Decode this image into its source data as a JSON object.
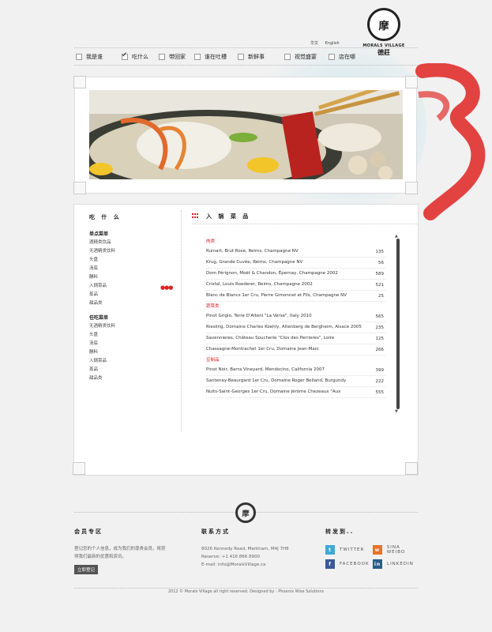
{
  "header": {
    "lang": [
      "华文",
      "English"
    ],
    "logo": {
      "seal": "摩",
      "brand": "MORALS VILLAGE",
      "cn": "德莊"
    }
  },
  "nav": [
    {
      "label": "我是谁",
      "checked": false
    },
    {
      "label": "吃什么",
      "checked": true
    },
    {
      "label": "带回家",
      "checked": false
    },
    {
      "label": "谁在吐槽",
      "checked": false
    },
    {
      "label": "新鲜事",
      "checked": false
    },
    {
      "label": "视觉盛宴",
      "checked": false
    },
    {
      "label": "店在哪",
      "checked": false
    }
  ],
  "sidebar": {
    "title": "吃 什 么",
    "group1": {
      "head": "单点菜单",
      "items": [
        "酒精类饮品",
        "无酒精类饮料",
        "头盘",
        "汤底",
        "酬料",
        "入锅菜品",
        "蒸品",
        "甜品类"
      ]
    },
    "group2": {
      "head": "任吃菜单",
      "items": [
        "无酒精类饮料",
        "头盘",
        "汤底",
        "酬料",
        "入锅菜品",
        "蒸品",
        "甜品类"
      ]
    }
  },
  "main": {
    "title": "入 锅 菜 品",
    "sections": [
      {
        "category": "肉类",
        "rows": [
          {
            "name": "Ruinart, Brut Rose, Reims, Champagne NV",
            "price": "135"
          },
          {
            "name": "Krug, Grande Cuvée, Reims, Champagne NV",
            "price": "56"
          },
          {
            "name": "Dom Pérignon, Moët & Chandon, Épernay, Champagne 2002",
            "price": "589"
          },
          {
            "name": "Cristal, Louis Roederer, Reims, Champagne 2002",
            "price": "521"
          },
          {
            "name": "Blanc de Blancs 1er Cru, Pierre Gimonnet et Fils, Champagne NV",
            "price": "25"
          }
        ]
      },
      {
        "category": "蔬菜类",
        "rows": [
          {
            "name": "Pinot Grigio, Terre D'Alteni \"La Versa\", Italy 2010",
            "price": "565"
          },
          {
            "name": "Riesling, Domaine Charles Koehly, Altenberg de Bergheim, Alsace 2005",
            "price": "235"
          },
          {
            "name": "Savennieres, Château Soucherie \"Clos des Perrieres\", Loire",
            "price": "125"
          },
          {
            "name": "Chassagne-Montrachet 1er Cru, Domaine Jean-Marc",
            "price": "266"
          }
        ]
      },
      {
        "category": "豆制品",
        "rows": [
          {
            "name": "Pinot Noir, Barra Vineyard, Mendocino, California 2007",
            "price": "399"
          },
          {
            "name": "Santenay-Beaurgard 1er Cru, Domaine Roger Belland, Burgundy",
            "price": "222"
          },
          {
            "name": "Nuits-Saint-Georges 1er Cru, Domaine Jérôme Chezeaux \"Aux",
            "price": "555"
          }
        ]
      }
    ]
  },
  "footer": {
    "members": {
      "title": "会员专区",
      "text": [
        "登记您的个人信息，成为我们的尊贵会员，将获",
        "得我们最新的优惠和资讯。"
      ],
      "button": "立即登记"
    },
    "contact": {
      "title": "联系方式",
      "lines": [
        "8026 Kennedy Road, Markham, M4J 7H8",
        "Reserve: +1 416 866 8900",
        "E-mail: info@MoralsVillage.ca"
      ]
    },
    "share": {
      "title": "转发到..",
      "items": [
        {
          "label": "TWITTER",
          "icon": "twitter-icon",
          "color": "#3fa9d6"
        },
        {
          "label": "SINA WEIBO",
          "icon": "weibo-icon",
          "color": "#e6732a"
        },
        {
          "label": "FACEBOOK",
          "icon": "facebook-icon",
          "color": "#3b5998"
        },
        {
          "label": "LINKEDIN",
          "icon": "linkedin-icon",
          "color": "#2b5b86"
        }
      ]
    },
    "copyright": "2012 © Morals Village all right reserved.   Designed by : Phoenix Wise Solutions"
  }
}
